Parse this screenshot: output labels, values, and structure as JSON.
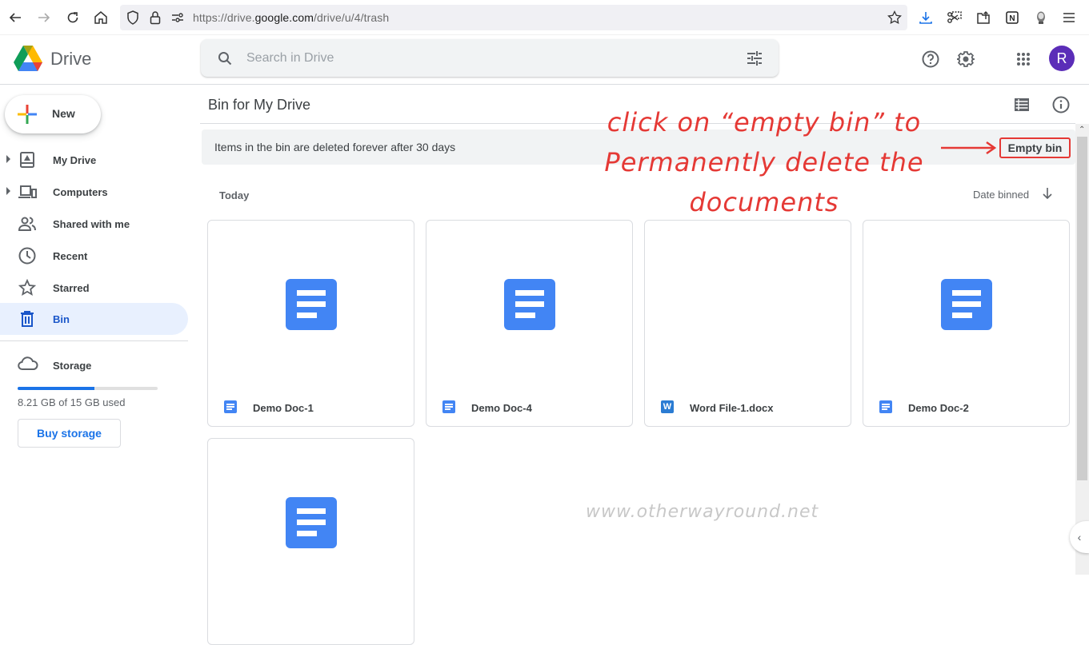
{
  "browser": {
    "url_prefix": "https://drive.",
    "url_domain": "google.com",
    "url_path": "/drive/u/4/trash",
    "icons": [
      "back-icon",
      "forward-icon",
      "reload-icon",
      "home-icon",
      "shield-icon",
      "lock-icon",
      "permissions-icon",
      "bookmark-star-icon",
      "download-icon",
      "screenshot-icon",
      "share-icon",
      "notion-icon",
      "profile-icon",
      "menu-icon"
    ]
  },
  "header": {
    "app_name": "Drive",
    "search_placeholder": "Search in Drive",
    "avatar_initial": "R",
    "avatar_color": "#5b2db8"
  },
  "sidebar": {
    "new_label": "New",
    "items": [
      {
        "label": "My Drive",
        "icon": "my-drive-icon",
        "expandable": true,
        "active": false
      },
      {
        "label": "Computers",
        "icon": "computers-icon",
        "expandable": true,
        "active": false
      },
      {
        "label": "Shared with me",
        "icon": "shared-icon",
        "expandable": false,
        "active": false
      },
      {
        "label": "Recent",
        "icon": "clock-icon",
        "expandable": false,
        "active": false
      },
      {
        "label": "Starred",
        "icon": "star-icon",
        "expandable": false,
        "active": false
      },
      {
        "label": "Bin",
        "icon": "trash-icon",
        "expandable": false,
        "active": true
      }
    ],
    "storage": {
      "label": "Storage",
      "used_text": "8.21 GB of 15 GB used",
      "used_fraction": 0.547,
      "buy_label": "Buy storage"
    }
  },
  "main": {
    "title": "Bin for My Drive",
    "banner_text": "Items in the bin are deleted forever after 30 days",
    "empty_bin_label": "Empty bin",
    "section_label": "Today",
    "sort_label": "Date binned",
    "files": [
      {
        "name": "Demo Doc-1",
        "type": "gdoc"
      },
      {
        "name": "Demo Doc-4",
        "type": "gdoc"
      },
      {
        "name": "Word File-1.docx",
        "type": "word"
      },
      {
        "name": "Demo Doc-2",
        "type": "gdoc"
      },
      {
        "name": "",
        "type": "gdoc"
      }
    ]
  },
  "annotation": {
    "line1": "click on “empty bin” to",
    "line2": "Permanently delete the",
    "line3": "documents",
    "color": "#e53935"
  },
  "watermark": "www.otherwayround.net",
  "colors": {
    "accent": "#1a73e8",
    "doc_blue": "#4285f4",
    "active_nav_bg": "#e8f0fe"
  }
}
